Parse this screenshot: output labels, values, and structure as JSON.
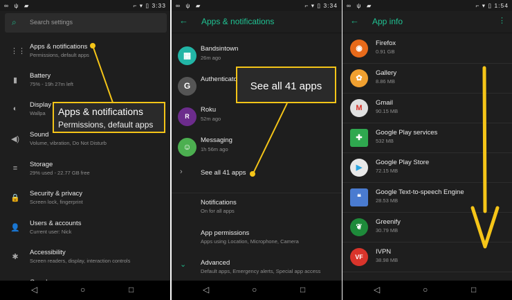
{
  "status_left_icons": "∞ ψ ▰",
  "status_right_icons": "⌐ ▾ ▯",
  "navbar": {
    "back": "◁",
    "home": "○",
    "recents": "□"
  },
  "screen1": {
    "time": "3:33",
    "search_placeholder": "Search settings",
    "items": [
      {
        "icon": "apps-grid-icon",
        "glyph": "⋮⋮",
        "title": "Apps & notifications",
        "subtitle": "Permissions, default apps"
      },
      {
        "icon": "battery-icon",
        "glyph": "▮",
        "title": "Battery",
        "subtitle": "75% - 19h 27m left"
      },
      {
        "icon": "brightness-icon",
        "glyph": "◐",
        "title": "Display",
        "subtitle": "Wallpa"
      },
      {
        "icon": "volume-icon",
        "glyph": "◀)",
        "title": "Sound",
        "subtitle": "Volume, vibration, Do Not Disturb"
      },
      {
        "icon": "storage-icon",
        "glyph": "≡",
        "title": "Storage",
        "subtitle": "29% used - 22.77 GB free"
      },
      {
        "icon": "lock-icon",
        "glyph": "🔒",
        "title": "Security & privacy",
        "subtitle": "Screen lock, fingerprint"
      },
      {
        "icon": "account-icon",
        "glyph": "👤",
        "title": "Users & accounts",
        "subtitle": "Current user: Nick"
      },
      {
        "icon": "accessibility-icon",
        "glyph": "✱",
        "title": "Accessibility",
        "subtitle": "Screen readers, display, interaction controls"
      },
      {
        "icon": "more-icon",
        "glyph": "",
        "title": "Google",
        "subtitle": ""
      }
    ],
    "callout_title": "Apps & notifications",
    "callout_subtitle": "Permissions, default apps"
  },
  "screen2": {
    "time": "3:34",
    "title": "Apps & notifications",
    "recent_apps": [
      {
        "name": "Bandsintown",
        "time": "26m ago",
        "color": "#22b5a6",
        "glyph": "▦"
      },
      {
        "name": "Authenticator",
        "time": "",
        "color": "#555555",
        "glyph": "G"
      },
      {
        "name": "Roku",
        "time": "52m ago",
        "color": "#6c2c8c",
        "glyph": "R"
      },
      {
        "name": "Messaging",
        "time": "1h 56m ago",
        "color": "#4caf50",
        "glyph": "☺"
      }
    ],
    "see_all": "See all 41 apps",
    "see_all_chevron": "›",
    "options": [
      {
        "title": "Notifications",
        "subtitle": "On for all apps"
      },
      {
        "title": "App permissions",
        "subtitle": "Apps using Location, Microphone, Camera"
      },
      {
        "title": "Advanced",
        "subtitle": "Default apps, Emergency alerts, Special app access"
      }
    ],
    "advanced_chevron": "⌄",
    "callout": "See all 41 apps"
  },
  "screen3": {
    "time": "1:54",
    "title": "App info",
    "apps": [
      {
        "name": "Firefox",
        "size": "0.91 GB",
        "color": "#e86a1a",
        "glyph": "◉"
      },
      {
        "name": "Gallery",
        "size": "8.86 MB",
        "color": "#f0a030",
        "glyph": "✿"
      },
      {
        "name": "Gmail",
        "size": "90.15 MB",
        "color": "#e0e0e0",
        "glyph": "M"
      },
      {
        "name": "Google Play services",
        "size": "532 MB",
        "color": "#2fa84f",
        "glyph": "✚"
      },
      {
        "name": "Google Play Store",
        "size": "72.15 MB",
        "color": "#e8e8e8",
        "glyph": "▶"
      },
      {
        "name": "Google Text-to-speech Engine",
        "size": "28.53 MB",
        "color": "#4a7bd0",
        "glyph": "❝"
      },
      {
        "name": "Greenify",
        "size": "30.79 MB",
        "color": "#1e8a3a",
        "glyph": "❦"
      },
      {
        "name": "IVPN",
        "size": "38.98 MB",
        "color": "#d9342b",
        "glyph": "VF"
      }
    ]
  },
  "colors": {
    "accent": "#1fb88a",
    "callout_border": "#f5c518",
    "background": "#1e1e1e"
  }
}
